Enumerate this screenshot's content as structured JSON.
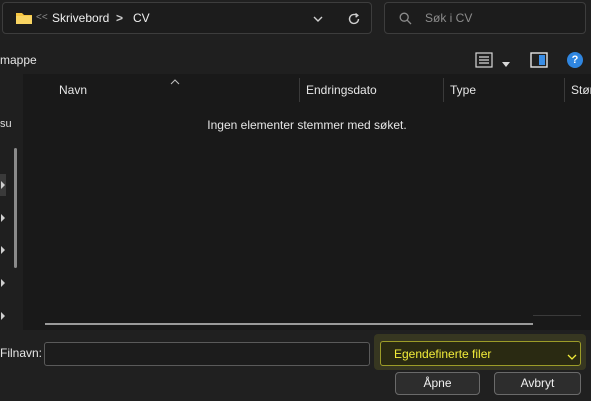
{
  "address_bar": {
    "overflow_marker": "<<",
    "breadcrumbs": [
      "Skrivebord",
      "CV"
    ],
    "separator": ">"
  },
  "search": {
    "placeholder": "Søk i CV"
  },
  "command_bar": {
    "new_folder_label": "mappe"
  },
  "nav_pane": {
    "partial_text": "su"
  },
  "file_list": {
    "columns": [
      "Navn",
      "Endringsdato",
      "Type",
      "Stør"
    ],
    "empty_message": "Ingen elementer stemmer med søket."
  },
  "bottom": {
    "filename_label": "Filnavn:",
    "filename_value": "",
    "file_type_filter": "Egendefinerte filer",
    "open_button": "Åpne",
    "cancel_button": "Avbryt"
  },
  "icons": {
    "folder": "folder-icon",
    "chevron_down": "chevron-down-icon",
    "refresh": "refresh-icon",
    "search": "search-icon",
    "view": "view-list-icon",
    "preview": "preview-pane-icon",
    "help": "help-icon",
    "help_glyph": "?"
  },
  "colors": {
    "filter_highlight": "#f2ec3a",
    "help_blue": "#2f86e0",
    "folder_yellow": "#f5c542"
  }
}
